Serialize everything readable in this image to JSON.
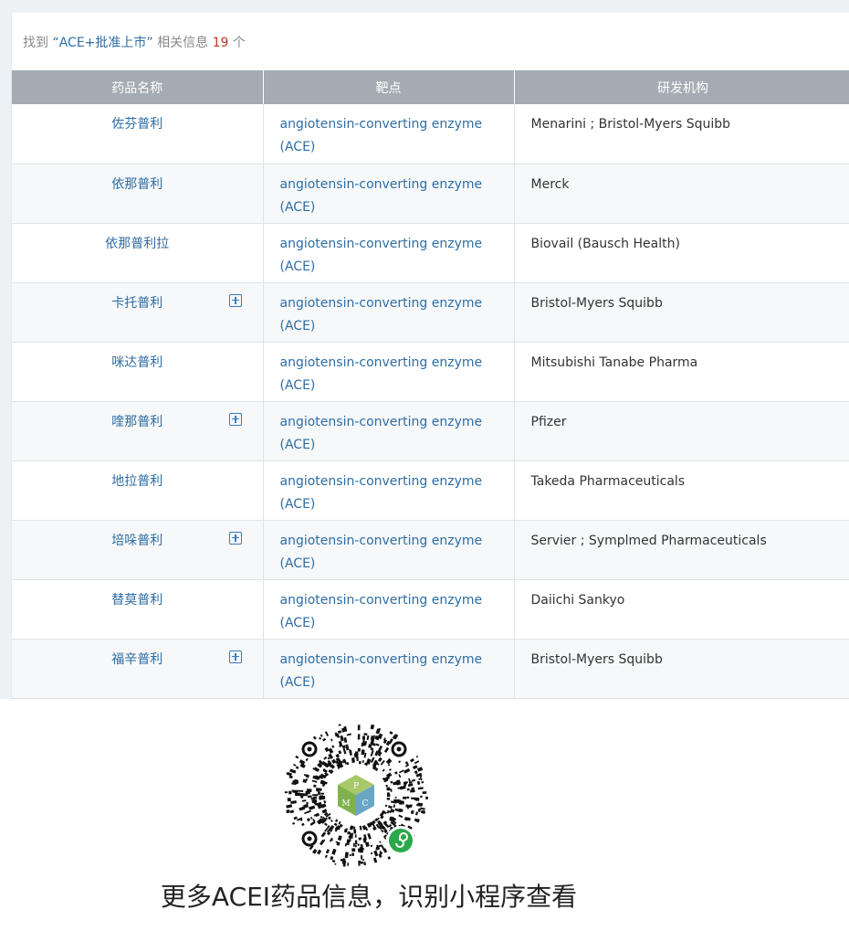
{
  "search": {
    "prefix": "找到",
    "query": "“ACE+批准上市”",
    "middle": " 相关信息 ",
    "count": "19",
    "suffix": " 个"
  },
  "table": {
    "headers": [
      "药品名称",
      "靶点",
      "研发机构"
    ],
    "rows": [
      {
        "name": "佐芬普利",
        "target": "angiotensin-converting enzyme (ACE)",
        "org": "Menarini ; Bristol-Myers Squibb",
        "expandable": false
      },
      {
        "name": "依那普利",
        "target": "angiotensin-converting enzyme (ACE)",
        "org": "Merck",
        "expandable": false
      },
      {
        "name": "依那普利拉",
        "target": "angiotensin-converting enzyme (ACE)",
        "org": "Biovail (Bausch Health)",
        "expandable": false
      },
      {
        "name": "卡托普利",
        "target": "angiotensin-converting enzyme (ACE)",
        "org": "Bristol-Myers Squibb",
        "expandable": true
      },
      {
        "name": "咪达普利",
        "target": "angiotensin-converting enzyme (ACE)",
        "org": "Mitsubishi Tanabe Pharma",
        "expandable": false
      },
      {
        "name": "喹那普利",
        "target": "angiotensin-converting enzyme (ACE)",
        "org": "Pfizer",
        "expandable": true
      },
      {
        "name": "地拉普利",
        "target": "angiotensin-converting enzyme (ACE)",
        "org": "Takeda Pharmaceuticals",
        "expandable": false
      },
      {
        "name": "培哚普利",
        "target": "angiotensin-converting enzyme (ACE)",
        "org": "Servier ; Symplmed Pharmaceuticals",
        "expandable": true
      },
      {
        "name": "替莫普利",
        "target": "angiotensin-converting enzyme (ACE)",
        "org": "Daiichi Sankyo",
        "expandable": false
      },
      {
        "name": "福辛普利",
        "target": "angiotensin-converting enzyme (ACE)",
        "org": "Bristol-Myers Squibb",
        "expandable": true
      }
    ]
  },
  "promo": {
    "caption": "更多ACEI药品信息，识别小程序查看",
    "qr_icon": "mini-program-qr-code",
    "logo_letters": [
      "P",
      "M",
      "C"
    ]
  },
  "colors": {
    "header_bg": "#a4abb2",
    "link": "#2e6da4",
    "count": "#c0392b"
  }
}
